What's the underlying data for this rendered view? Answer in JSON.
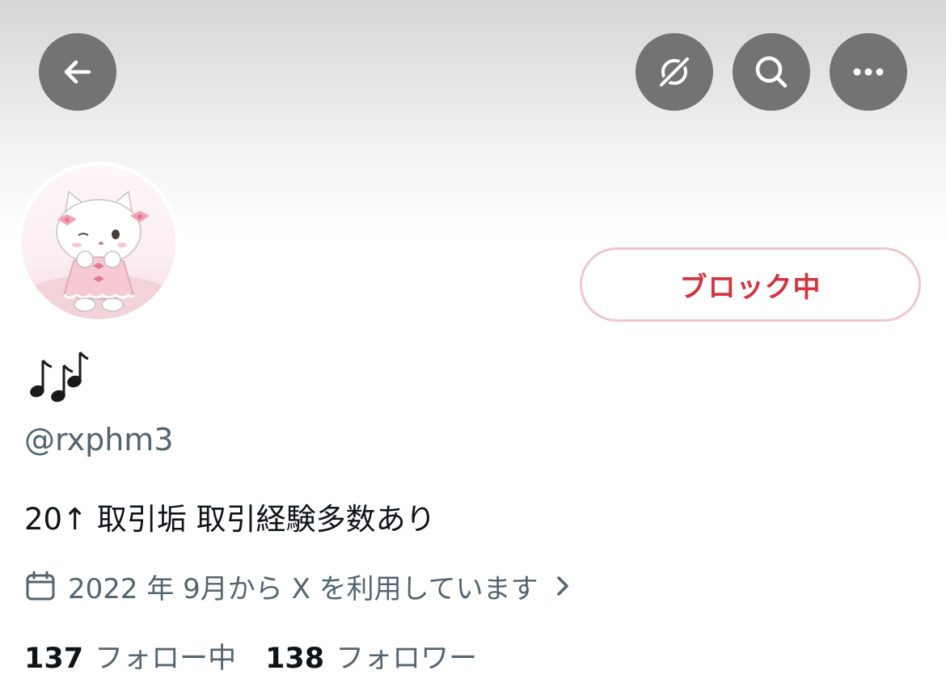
{
  "header": {
    "back_icon": "arrow-left-icon",
    "actions": [
      {
        "name": "translate-off-icon"
      },
      {
        "name": "search-icon"
      },
      {
        "name": "more-icon"
      }
    ]
  },
  "profile": {
    "avatar": "pink-cat-avatar",
    "block_button_label": "ブロック中",
    "display_name": "🎶",
    "handle": "@rxphm3",
    "bio": "20↑ 取引垢 取引経験多数あり",
    "joined": "2022 年 9月から X を利用しています",
    "following_count": "137",
    "following_label": "フォロー中",
    "followers_count": "138",
    "followers_label": "フォロワー"
  },
  "colors": {
    "block_text": "#d3343f",
    "block_border": "#f3c6cc",
    "secondary_text": "#536471",
    "header_button_bg": "#737373"
  }
}
